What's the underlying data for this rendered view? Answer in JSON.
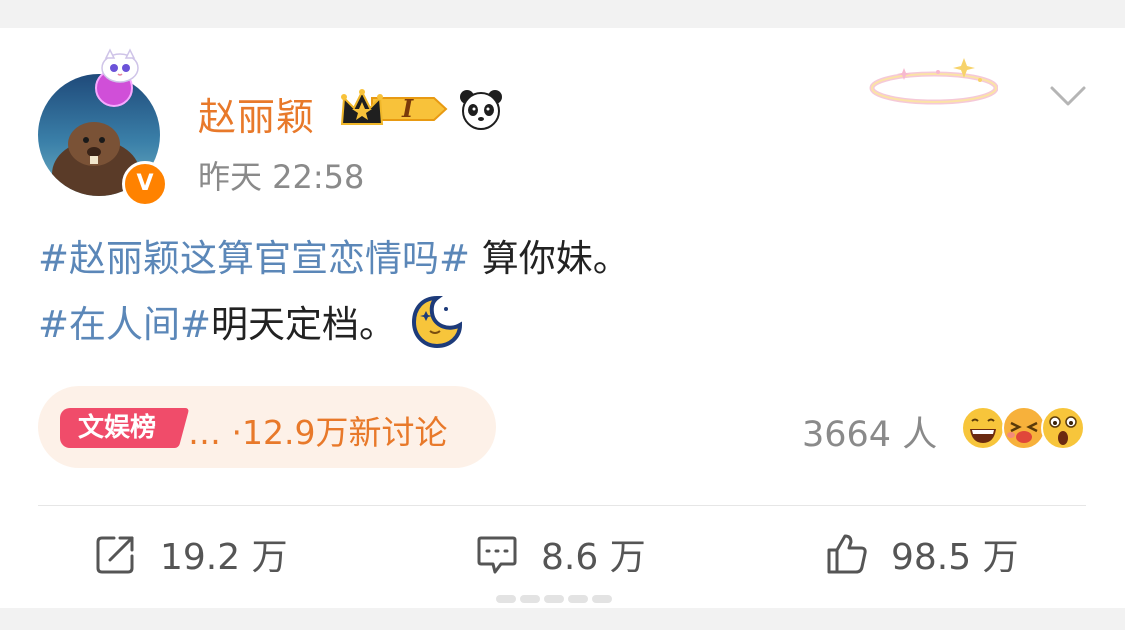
{
  "user": {
    "name": "赵丽颖",
    "vip_level": "I",
    "post_time": "昨天  22:58"
  },
  "post": {
    "lines": [
      {
        "tag": "#赵丽颖这算官宣恋情吗#",
        "text": " 算你妹。"
      },
      {
        "tag": "#在人间#",
        "text": "明天定档。"
      }
    ]
  },
  "hot_topic": {
    "badge": "文娱榜",
    "text": "… ·12.9万新讨论"
  },
  "reactions": {
    "count": "3664 人"
  },
  "actions": {
    "repost": "19.2 万",
    "comment": "8.6 万",
    "like": "98.5 万"
  },
  "colors": {
    "username": "#e8792a",
    "tag": "#5b87b8",
    "badge_red": "#f04c6a",
    "verified": "#ff8200"
  },
  "icons": [
    "chevron-down-icon",
    "repost-icon",
    "comment-icon",
    "like-icon",
    "moon-emoji-icon",
    "panda-icon",
    "crown-icon"
  ]
}
